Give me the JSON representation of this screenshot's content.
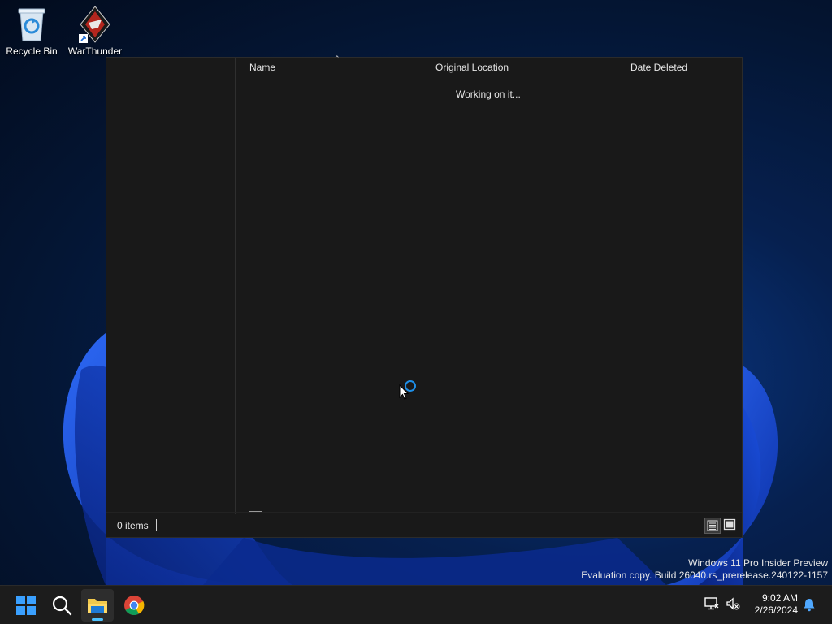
{
  "desktop": {
    "icons": [
      {
        "label": "Recycle Bin",
        "icon": "recycle-bin-icon"
      },
      {
        "label": "WarThunder",
        "icon": "warthunder-icon"
      }
    ],
    "watermark": {
      "line1": "Windows 11 Pro Insider Preview",
      "line2": "Evaluation copy. Build 26040.rs_prerelease.240122-1157"
    }
  },
  "explorer": {
    "columns": [
      "Name",
      "Original Location",
      "Date Deleted"
    ],
    "status_message": "Working on it...",
    "item_count": "0 items",
    "views": [
      "details-view-icon",
      "tiles-view-icon"
    ]
  },
  "taskbar": {
    "apps": [
      "start-icon",
      "search-icon",
      "file-explorer-icon",
      "chrome-icon"
    ],
    "active_app": "file-explorer-icon",
    "tray": [
      "network-icon",
      "volume-muted-icon",
      "notification-bell-icon"
    ],
    "time": "9:02 AM",
    "date": "2/26/2024"
  },
  "colors": {
    "accent": "#1e8fe8",
    "window_bg": "#191919",
    "taskbar_bg": "#1c1c1c"
  }
}
